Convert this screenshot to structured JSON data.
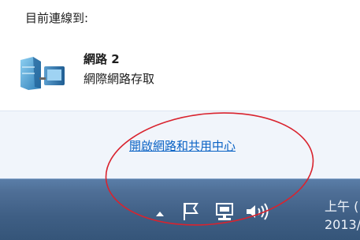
{
  "flyout": {
    "heading": "目前連線到:",
    "network": {
      "name": "網路  2",
      "status": "網際網路存取",
      "icon": "network-computer-icon"
    },
    "footer_link": "開啟網路和共用中心"
  },
  "taskbar": {
    "tray_icons": [
      "show-hidden-icons-arrow",
      "action-center-flag-icon",
      "network-tray-icon",
      "speaker-volume-icon"
    ],
    "clock_time": "上午 (",
    "clock_date": "2013/"
  },
  "annotation": {
    "color": "#d9232e"
  }
}
